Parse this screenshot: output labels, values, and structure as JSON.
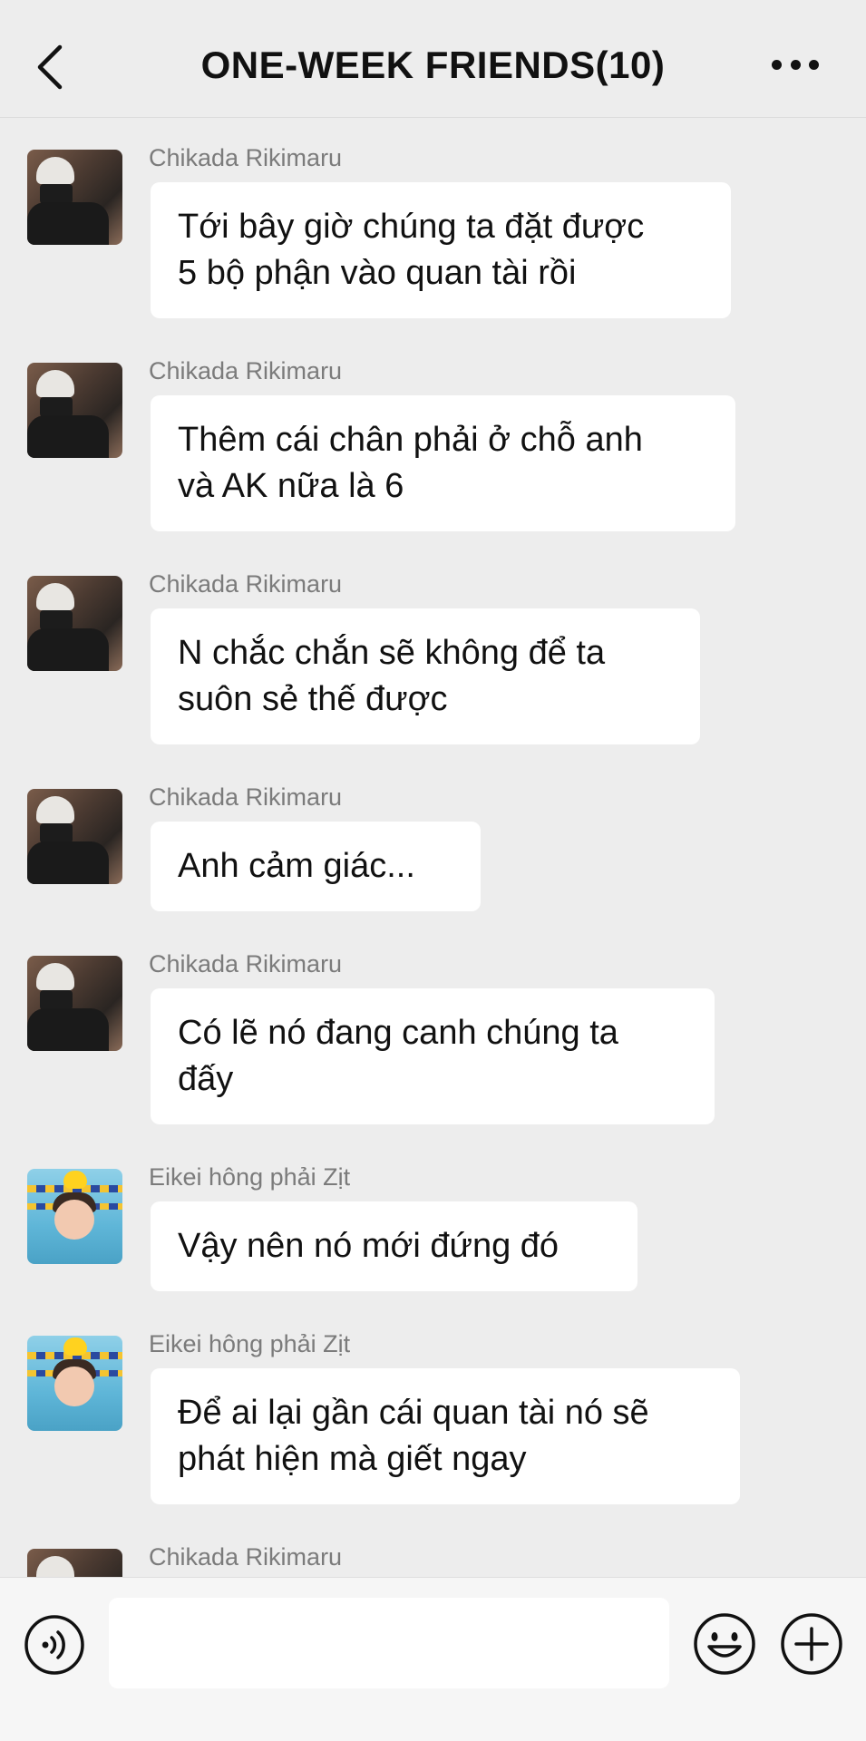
{
  "header": {
    "title": "ONE-WEEK FRIENDS(10)",
    "back_icon": "chevron-left-icon",
    "more_icon": "more-dots-icon"
  },
  "messages": [
    {
      "sender": "Chikada Rikimaru",
      "text": "Tới bây giờ chúng ta đặt được\n5 bộ phận vào quan tài rồi",
      "avatar": "a1"
    },
    {
      "sender": "Chikada Rikimaru",
      "text": "Thêm cái chân phải ở chỗ anh\nvà AK nữa là 6",
      "avatar": "a1"
    },
    {
      "sender": "Chikada Rikimaru",
      "text": "N chắc chắn sẽ không để ta\nsuôn sẻ thế được",
      "avatar": "a1"
    },
    {
      "sender": "Chikada Rikimaru",
      "text": "Anh cảm giác...",
      "avatar": "a1"
    },
    {
      "sender": "Chikada Rikimaru",
      "text": "Có lẽ nó đang canh chúng ta\nđấy",
      "avatar": "a1"
    },
    {
      "sender": "Eikei hông phải Zịt",
      "text": "Vậy nên nó mới đứng đó",
      "avatar": "a2"
    },
    {
      "sender": "Eikei hông phải Zịt",
      "text": "Để ai lại gần cái quan tài nó sẽ\nphát hiện mà giết ngay",
      "avatar": "a2"
    },
    {
      "sender": "Chikada Rikimaru",
      "text": "",
      "avatar": "a1"
    }
  ],
  "input": {
    "value": "",
    "voice_icon": "voice-icon",
    "emoji_icon": "emoji-icon",
    "plus_icon": "plus-icon"
  }
}
